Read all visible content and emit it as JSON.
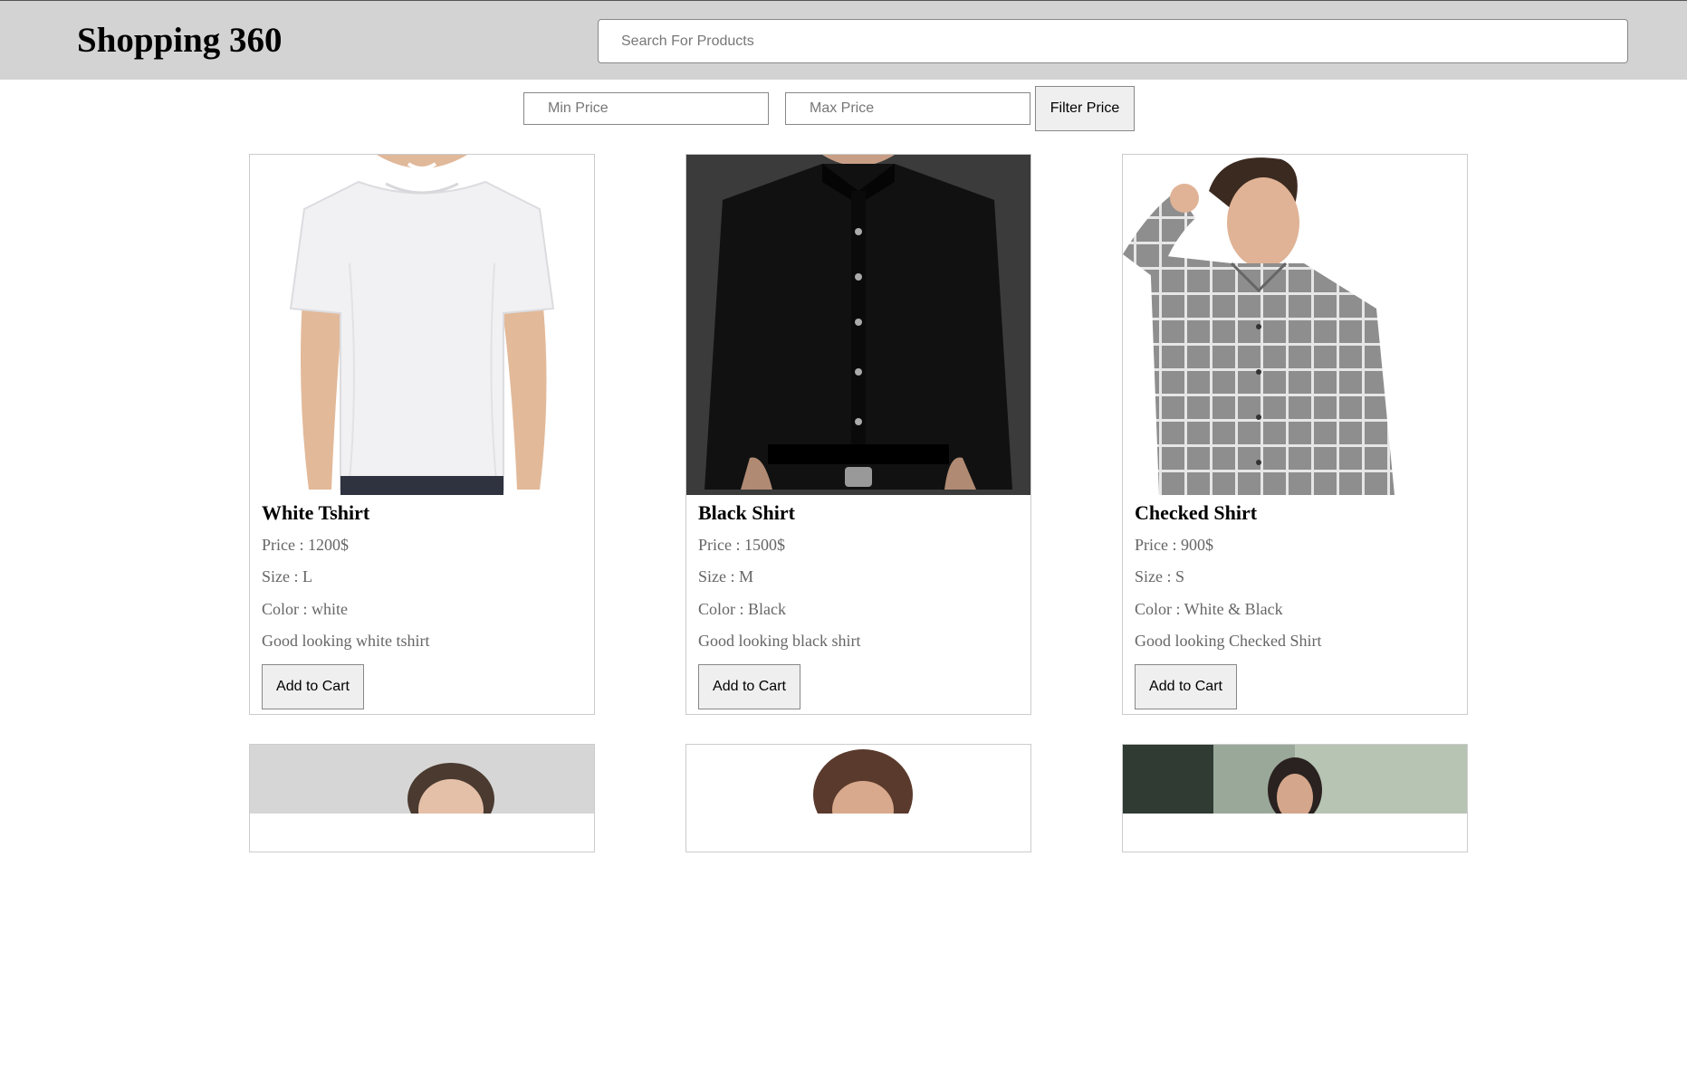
{
  "header": {
    "brand": "Shopping 360",
    "search_placeholder": "Search For Products"
  },
  "filter": {
    "min_placeholder": "Min Price",
    "max_placeholder": "Max Price",
    "button_label": "Filter Price"
  },
  "products": [
    {
      "name": "White Tshirt",
      "price": "Price : 1200$",
      "size": "Size : L",
      "color": "Color : white",
      "description": "Good looking white tshirt",
      "button": "Add to Cart"
    },
    {
      "name": "Black Shirt",
      "price": "Price : 1500$",
      "size": "Size : M",
      "color": "Color : Black",
      "description": "Good looking black shirt",
      "button": "Add to Cart"
    },
    {
      "name": "Checked Shirt",
      "price": "Price : 900$",
      "size": "Size : S",
      "color": "Color : White & Black",
      "description": "Good looking Checked Shirt",
      "button": "Add to Cart"
    }
  ]
}
